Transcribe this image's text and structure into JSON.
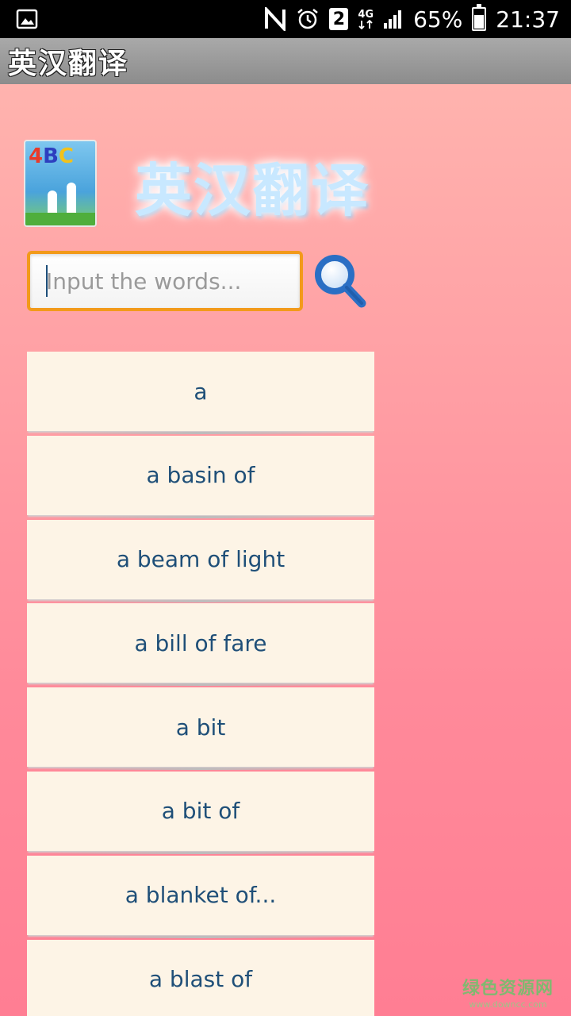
{
  "status_bar": {
    "net_type": "4G",
    "sim_slot": "2",
    "battery_percent": "65%",
    "battery_level": 0.65,
    "time": "21:37"
  },
  "app_title": "英汉翻译",
  "logo_title": "英汉翻译",
  "logo_letters": "ABC",
  "search": {
    "placeholder": "Input the words..."
  },
  "word_list": [
    "a",
    "a basin of",
    "a beam of light",
    "a bill of fare",
    "a bit",
    "a bit of",
    "a blanket of...",
    "a blast of"
  ],
  "watermark": {
    "name": "绿色资源网",
    "url": "www.downcc.com"
  },
  "colors": {
    "accent_orange": "#f29a1a",
    "search_icon_blue": "#2a6fc4",
    "item_text": "#1f4f78",
    "item_bg": "#fdf4e6",
    "bg_top": "#ffb3ae",
    "bg_bottom": "#ff7e93"
  }
}
